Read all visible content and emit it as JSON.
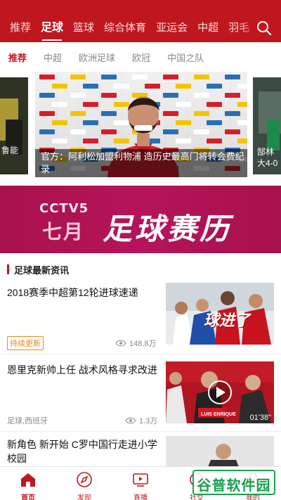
{
  "top_nav": {
    "tabs": [
      "推荐",
      "足球",
      "篮球",
      "综合体育",
      "亚运会",
      "中超",
      "羽毛"
    ],
    "active_index": 1
  },
  "sub_nav": {
    "tabs": [
      "推荐",
      "中超",
      "欧洲足球",
      "欧冠",
      "中国之队"
    ],
    "active_index": 0
  },
  "carousel": {
    "left_caption": "鲁能",
    "main_caption": "官方：阿利松加盟利物浦 造历史最高门将转会费纪录",
    "right_caption_line1": "郜林",
    "right_caption_line2": "大4-0"
  },
  "banner": {
    "cctv": "CCTV5",
    "month": "七月",
    "title": "足球赛历"
  },
  "section": {
    "title": "足球最新资讯"
  },
  "news": [
    {
      "headline": "2018赛季中超第12轮进球速递",
      "tag": "持续更新",
      "views": "148.8万",
      "thumb_text": "球进了"
    },
    {
      "headline": "恩里克新帅上任 战术风格寻求改进",
      "source": "足球,西班牙",
      "views": "1.3万",
      "duration": "01'38\"",
      "thumb_text": "LUIS ENRIQUE"
    },
    {
      "headline": "新角色 新开始 C罗中国行走进小学校园"
    }
  ],
  "tabbar": [
    {
      "label": "首页",
      "icon": "home-icon"
    },
    {
      "label": "发现",
      "icon": "compass-icon"
    },
    {
      "label": "直播",
      "icon": "tv-play-icon"
    },
    {
      "label": "社交",
      "icon": "social-icon"
    },
    {
      "label": "我的",
      "icon": "profile-icon"
    }
  ],
  "watermark": "谷普软件园",
  "colors": {
    "brand": "#c0171e",
    "tag_orange": "#e8891a",
    "banner": "#b6145a"
  }
}
